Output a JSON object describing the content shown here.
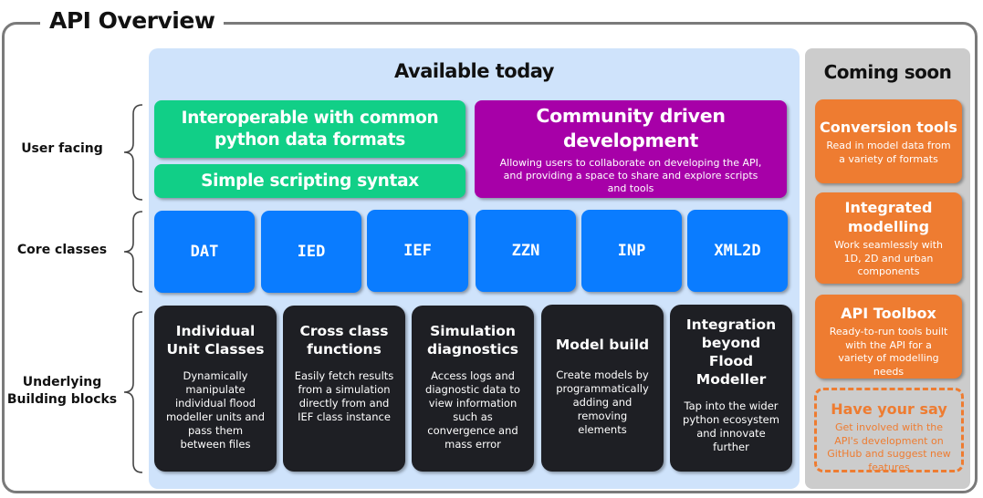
{
  "title": "API Overview",
  "available": {
    "title": "Available today",
    "user_facing": {
      "interop": "Interoperable with common python data formats",
      "scripting": "Simple scripting syntax",
      "community_title": "Community driven development",
      "community_desc": "Allowing users to collaborate on developing the API, and providing a space to share and explore scripts and tools"
    },
    "core_classes": [
      "DAT",
      "IED",
      "IEF",
      "ZZN",
      "INP",
      "XML2D"
    ],
    "building_blocks": [
      {
        "title": "Individual Unit Classes",
        "desc": "Dynamically manipulate individual flood modeller units and pass them between files"
      },
      {
        "title": "Cross class functions",
        "desc": "Easily fetch results from a simulation directly from and IEF class instance"
      },
      {
        "title": "Simulation diagnostics",
        "desc": "Access logs and diagnostic data to view information such as convergence and mass error"
      },
      {
        "title": "Model build",
        "desc": "Create models by programmatically adding and removing elements"
      },
      {
        "title": "Integration beyond Flood Modeller",
        "desc": "Tap into the wider python ecosystem and innovate further"
      }
    ]
  },
  "row_labels": {
    "user_facing": "User facing",
    "core_classes": "Core classes",
    "building_blocks": "Underlying Building blocks"
  },
  "coming_soon": {
    "title": "Coming soon",
    "items": [
      {
        "title": "Conversion tools",
        "desc": "Read in model data from a variety of formats"
      },
      {
        "title": "Integrated modelling",
        "desc": "Work seamlessly with 1D, 2D and urban components"
      },
      {
        "title": "API Toolbox",
        "desc": "Ready-to-run tools built with the API for a variety of modelling needs"
      }
    ],
    "have_your_say": {
      "title": "Have your say",
      "desc": "Get involved with the API's development on GitHub and suggest new features"
    }
  },
  "colors": {
    "user_facing_green": "#11cf87",
    "community_purple": "#a700a8",
    "core_blue": "#0a7cff",
    "block_dark": "#1e1f24",
    "coming_orange": "#ee7c31",
    "today_bg": "#cfe3fb",
    "soon_bg": "#cccccc"
  }
}
